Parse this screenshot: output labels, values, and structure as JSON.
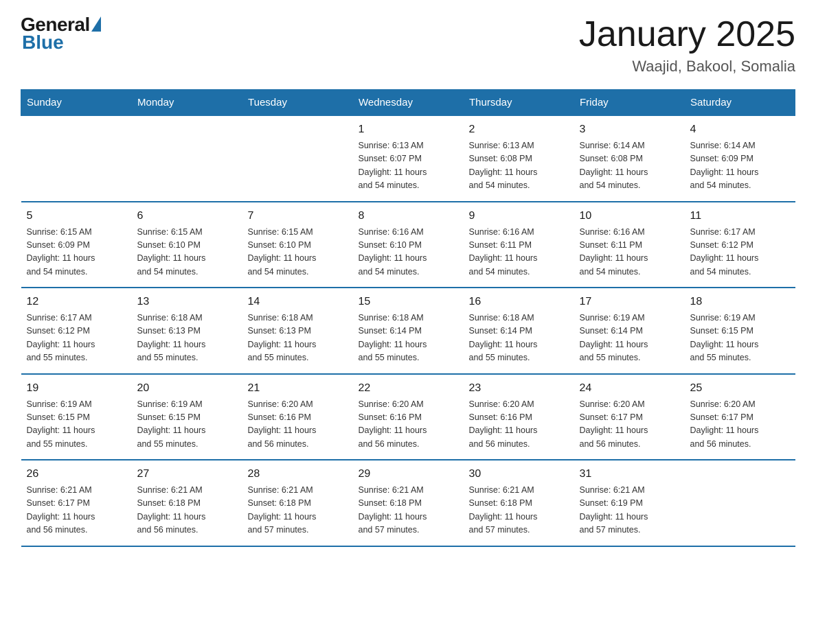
{
  "logo": {
    "general": "General",
    "blue": "Blue"
  },
  "title": "January 2025",
  "location": "Waajid, Bakool, Somalia",
  "days_of_week": [
    "Sunday",
    "Monday",
    "Tuesday",
    "Wednesday",
    "Thursday",
    "Friday",
    "Saturday"
  ],
  "weeks": [
    [
      {
        "day": "",
        "info": ""
      },
      {
        "day": "",
        "info": ""
      },
      {
        "day": "",
        "info": ""
      },
      {
        "day": "1",
        "info": "Sunrise: 6:13 AM\nSunset: 6:07 PM\nDaylight: 11 hours\nand 54 minutes."
      },
      {
        "day": "2",
        "info": "Sunrise: 6:13 AM\nSunset: 6:08 PM\nDaylight: 11 hours\nand 54 minutes."
      },
      {
        "day": "3",
        "info": "Sunrise: 6:14 AM\nSunset: 6:08 PM\nDaylight: 11 hours\nand 54 minutes."
      },
      {
        "day": "4",
        "info": "Sunrise: 6:14 AM\nSunset: 6:09 PM\nDaylight: 11 hours\nand 54 minutes."
      }
    ],
    [
      {
        "day": "5",
        "info": "Sunrise: 6:15 AM\nSunset: 6:09 PM\nDaylight: 11 hours\nand 54 minutes."
      },
      {
        "day": "6",
        "info": "Sunrise: 6:15 AM\nSunset: 6:10 PM\nDaylight: 11 hours\nand 54 minutes."
      },
      {
        "day": "7",
        "info": "Sunrise: 6:15 AM\nSunset: 6:10 PM\nDaylight: 11 hours\nand 54 minutes."
      },
      {
        "day": "8",
        "info": "Sunrise: 6:16 AM\nSunset: 6:10 PM\nDaylight: 11 hours\nand 54 minutes."
      },
      {
        "day": "9",
        "info": "Sunrise: 6:16 AM\nSunset: 6:11 PM\nDaylight: 11 hours\nand 54 minutes."
      },
      {
        "day": "10",
        "info": "Sunrise: 6:16 AM\nSunset: 6:11 PM\nDaylight: 11 hours\nand 54 minutes."
      },
      {
        "day": "11",
        "info": "Sunrise: 6:17 AM\nSunset: 6:12 PM\nDaylight: 11 hours\nand 54 minutes."
      }
    ],
    [
      {
        "day": "12",
        "info": "Sunrise: 6:17 AM\nSunset: 6:12 PM\nDaylight: 11 hours\nand 55 minutes."
      },
      {
        "day": "13",
        "info": "Sunrise: 6:18 AM\nSunset: 6:13 PM\nDaylight: 11 hours\nand 55 minutes."
      },
      {
        "day": "14",
        "info": "Sunrise: 6:18 AM\nSunset: 6:13 PM\nDaylight: 11 hours\nand 55 minutes."
      },
      {
        "day": "15",
        "info": "Sunrise: 6:18 AM\nSunset: 6:14 PM\nDaylight: 11 hours\nand 55 minutes."
      },
      {
        "day": "16",
        "info": "Sunrise: 6:18 AM\nSunset: 6:14 PM\nDaylight: 11 hours\nand 55 minutes."
      },
      {
        "day": "17",
        "info": "Sunrise: 6:19 AM\nSunset: 6:14 PM\nDaylight: 11 hours\nand 55 minutes."
      },
      {
        "day": "18",
        "info": "Sunrise: 6:19 AM\nSunset: 6:15 PM\nDaylight: 11 hours\nand 55 minutes."
      }
    ],
    [
      {
        "day": "19",
        "info": "Sunrise: 6:19 AM\nSunset: 6:15 PM\nDaylight: 11 hours\nand 55 minutes."
      },
      {
        "day": "20",
        "info": "Sunrise: 6:19 AM\nSunset: 6:15 PM\nDaylight: 11 hours\nand 55 minutes."
      },
      {
        "day": "21",
        "info": "Sunrise: 6:20 AM\nSunset: 6:16 PM\nDaylight: 11 hours\nand 56 minutes."
      },
      {
        "day": "22",
        "info": "Sunrise: 6:20 AM\nSunset: 6:16 PM\nDaylight: 11 hours\nand 56 minutes."
      },
      {
        "day": "23",
        "info": "Sunrise: 6:20 AM\nSunset: 6:16 PM\nDaylight: 11 hours\nand 56 minutes."
      },
      {
        "day": "24",
        "info": "Sunrise: 6:20 AM\nSunset: 6:17 PM\nDaylight: 11 hours\nand 56 minutes."
      },
      {
        "day": "25",
        "info": "Sunrise: 6:20 AM\nSunset: 6:17 PM\nDaylight: 11 hours\nand 56 minutes."
      }
    ],
    [
      {
        "day": "26",
        "info": "Sunrise: 6:21 AM\nSunset: 6:17 PM\nDaylight: 11 hours\nand 56 minutes."
      },
      {
        "day": "27",
        "info": "Sunrise: 6:21 AM\nSunset: 6:18 PM\nDaylight: 11 hours\nand 56 minutes."
      },
      {
        "day": "28",
        "info": "Sunrise: 6:21 AM\nSunset: 6:18 PM\nDaylight: 11 hours\nand 57 minutes."
      },
      {
        "day": "29",
        "info": "Sunrise: 6:21 AM\nSunset: 6:18 PM\nDaylight: 11 hours\nand 57 minutes."
      },
      {
        "day": "30",
        "info": "Sunrise: 6:21 AM\nSunset: 6:18 PM\nDaylight: 11 hours\nand 57 minutes."
      },
      {
        "day": "31",
        "info": "Sunrise: 6:21 AM\nSunset: 6:19 PM\nDaylight: 11 hours\nand 57 minutes."
      },
      {
        "day": "",
        "info": ""
      }
    ]
  ]
}
